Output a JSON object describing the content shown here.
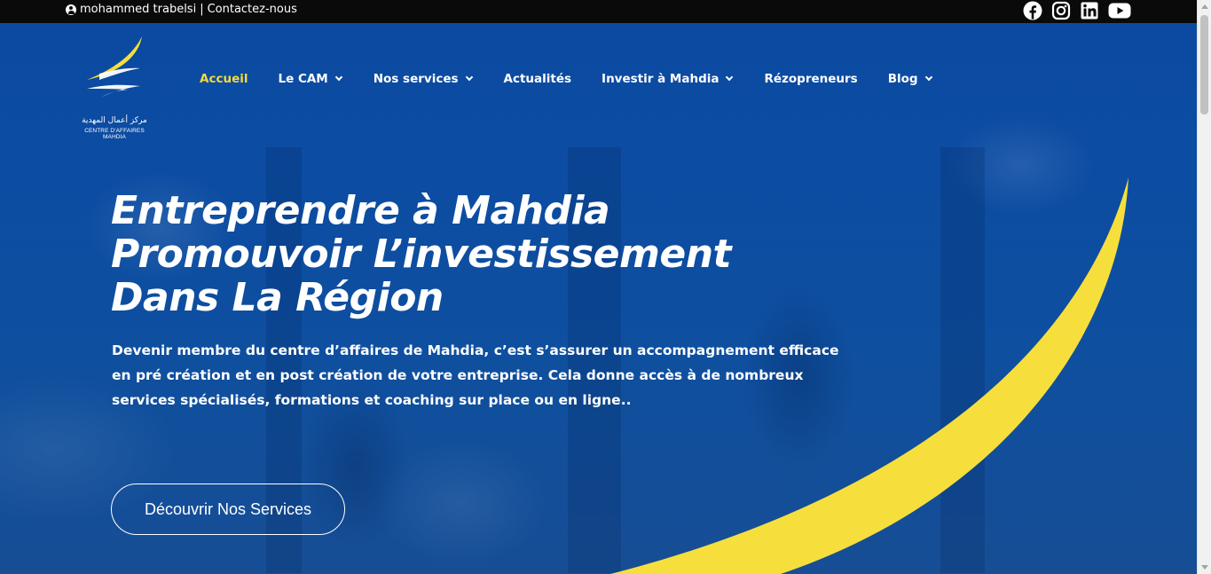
{
  "topbar": {
    "user_name": "mohammed trabelsi",
    "separator": "|",
    "contact_label": "Contactez-nous"
  },
  "social": {
    "icons": [
      "facebook-icon",
      "instagram-icon",
      "linkedin-icon",
      "youtube-icon"
    ]
  },
  "logo": {
    "arabic_text": "مركز أعمال المهدية",
    "french_text": "CENTRE D'AFFAIRES MAHDIA"
  },
  "nav": {
    "items": [
      {
        "label": "Accueil",
        "active": true,
        "dropdown": false
      },
      {
        "label": "Le CAM",
        "active": false,
        "dropdown": true
      },
      {
        "label": "Nos services",
        "active": false,
        "dropdown": true
      },
      {
        "label": "Actualités",
        "active": false,
        "dropdown": false
      },
      {
        "label": "Investir à Mahdia",
        "active": false,
        "dropdown": true
      },
      {
        "label": "Rézopreneurs",
        "active": false,
        "dropdown": false
      },
      {
        "label": "Blog",
        "active": false,
        "dropdown": true
      }
    ]
  },
  "hero": {
    "headline_line1": "Entreprendre à Mahdia",
    "headline_line2": "Promouvoir L’investissement",
    "headline_line3": "Dans La Région",
    "intro": "Devenir membre du centre d’affaires de Mahdia, c’est s’assurer un accompagnement efficace en pré création et en post création de votre entreprise. Cela donne accès à de nombreux services spécialisés, formations et coaching sur place ou en ligne..",
    "cta_label": "Découvrir Nos Services"
  },
  "colors": {
    "brand_blue": "#0b4aa0",
    "accent_yellow": "#f6d93a",
    "topbar": "#0a0a0a"
  }
}
